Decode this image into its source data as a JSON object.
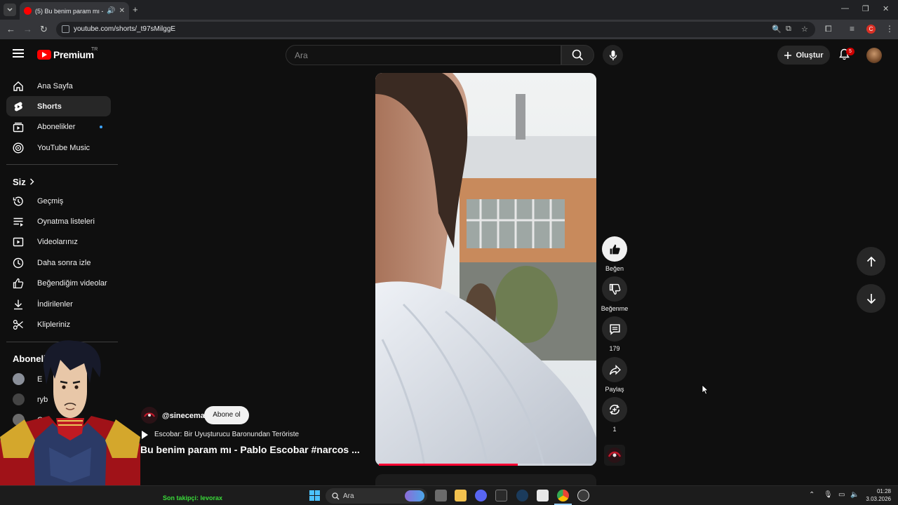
{
  "browser": {
    "tab_title": "(5) Bu benim param mı - Pa",
    "url": "youtube.com/shorts/_t97sMilggE",
    "new_tab": "+",
    "tab_close": "✕"
  },
  "masthead": {
    "logo_text": "Premium",
    "region": "TR",
    "search_placeholder": "Ara",
    "create_label": "Oluştur",
    "notification_count": "5"
  },
  "sidebar": {
    "main_items": [
      {
        "label": "Ana Sayfa",
        "icon": "home-icon"
      },
      {
        "label": "Shorts",
        "icon": "shorts-icon",
        "active": true
      },
      {
        "label": "Abonelikler",
        "icon": "subscriptions-icon",
        "dot": true
      },
      {
        "label": "YouTube Music",
        "icon": "music-icon"
      }
    ],
    "you_header": "Siz",
    "you_items": [
      {
        "label": "Geçmiş",
        "icon": "history-icon"
      },
      {
        "label": "Oynatma listeleri",
        "icon": "playlists-icon"
      },
      {
        "label": "Videolarınız",
        "icon": "your-videos-icon"
      },
      {
        "label": "Daha sonra izle",
        "icon": "watch-later-icon"
      },
      {
        "label": "Beğendiğim videolar",
        "icon": "liked-videos-icon"
      },
      {
        "label": "İndirilenler",
        "icon": "downloads-icon"
      },
      {
        "label": "Klipleriniz",
        "icon": "clips-icon"
      }
    ],
    "subs_header": "Abonelik",
    "subs": [
      {
        "name": "E"
      },
      {
        "name": "ryb"
      },
      {
        "name": "O"
      }
    ]
  },
  "short": {
    "channel": "@sinecema",
    "subscribe_label": "Abone ol",
    "film_link": "Escobar: Bir Uyuşturucu Baronundan Teröriste",
    "title": "Bu benim param mı - Pablo Escobar #narcos ...",
    "progress": 0.65
  },
  "actions": {
    "like_label": "Beğen",
    "dislike_label": "Beğenme",
    "comment_count": "179",
    "share_label": "Paylaş",
    "remix_count": "1"
  },
  "taskbar": {
    "follower_text": "Son takipçi: levorax",
    "search_text": "Ara",
    "time": "01:28",
    "date": "3.03.2026"
  }
}
